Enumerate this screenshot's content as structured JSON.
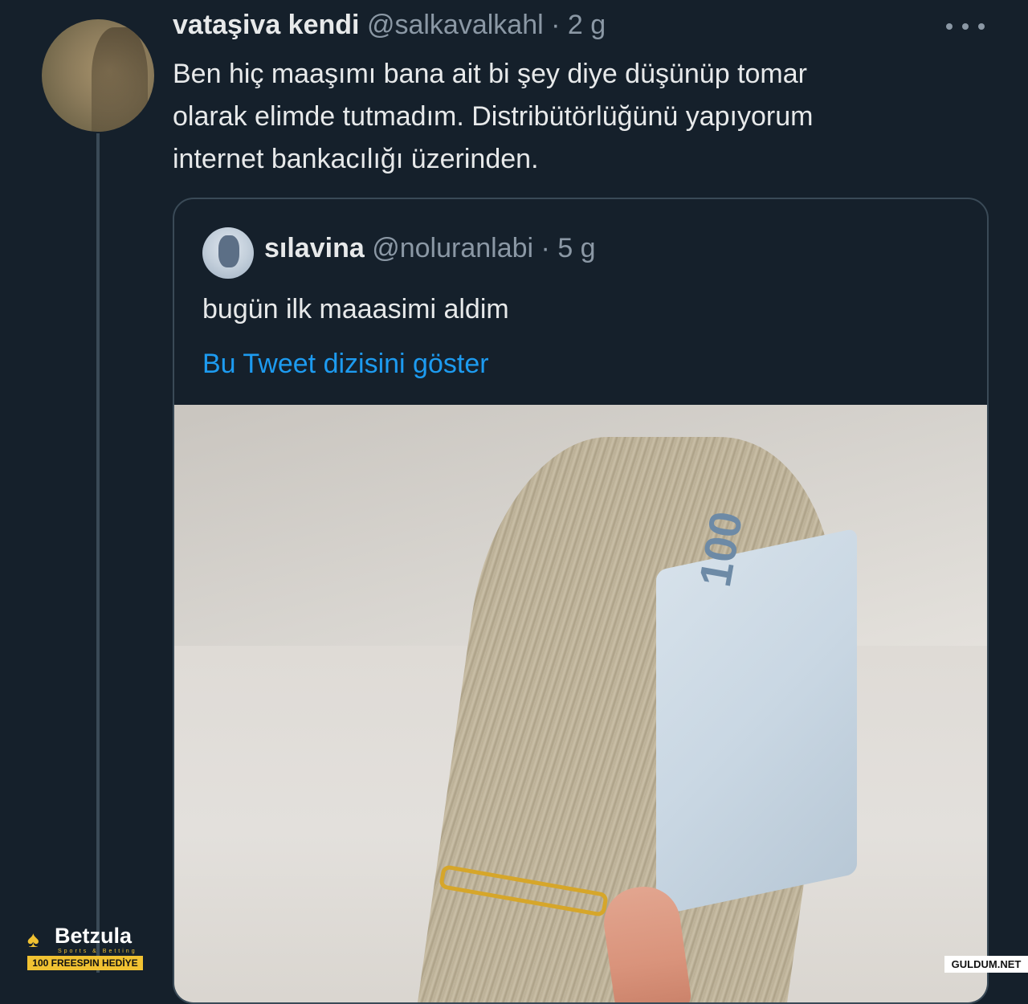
{
  "tweet": {
    "display_name": "vataşiva kendi",
    "handle": "@salkavalkahl",
    "separator": "·",
    "time": "2 g",
    "text_lines": [
      "Ben hiç maaşımı bana ait bi şey diye düşünüp tomar",
      "olarak elimde tutmadım. Distribütörlüğünü yapıyorum",
      "internet bankacılığı üzerinden."
    ]
  },
  "quote": {
    "display_name": "sılavina",
    "handle": "@noluranlabi",
    "separator": "·",
    "time": "5 g",
    "text": "bugün ilk maaasimi aldim",
    "show_thread_label": "Bu Tweet dizisini göster",
    "note_value": "100"
  },
  "overlay": {
    "logo_name": "Betzula",
    "logo_tagline": "Sports & Betting",
    "logo_promo": "100 FREESPIN HEDİYE",
    "watermark": "GULDUM.NET",
    "accent_color": "#f1c232",
    "link_color": "#1d9bf0",
    "background_color": "#15202b"
  },
  "icons": {
    "more": "more-horizontal-icon",
    "logo_mark": "spade-icon"
  }
}
